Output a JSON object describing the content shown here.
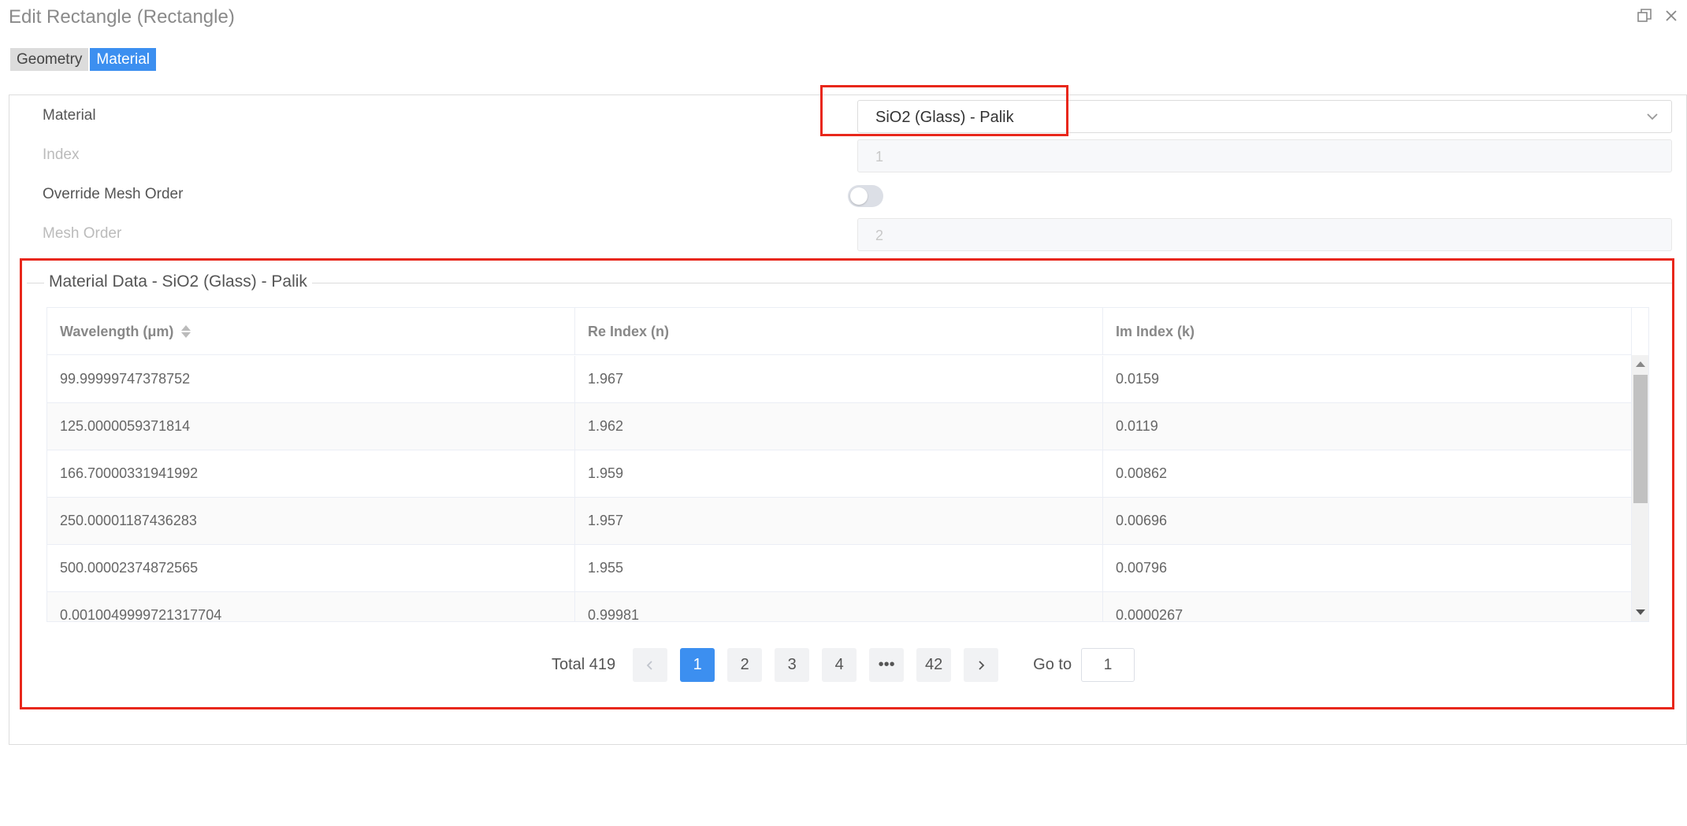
{
  "window": {
    "title": "Edit Rectangle (Rectangle)",
    "icons": [
      "restore-icon",
      "close-icon"
    ]
  },
  "tabs": [
    {
      "label": "Geometry",
      "active": false
    },
    {
      "label": "Material",
      "active": true
    }
  ],
  "form": {
    "material_label": "Material",
    "material_value": "SiO2 (Glass) - Palik",
    "index_label": "Index",
    "index_value": "1",
    "override_label": "Override Mesh Order",
    "override_on": false,
    "mesh_order_label": "Mesh Order",
    "mesh_order_value": "2"
  },
  "material_data": {
    "legend": "Material Data - SiO2 (Glass) - Palik",
    "columns": [
      "Wavelength (μm)",
      "Re Index (n)",
      "Im Index (k)"
    ],
    "rows": [
      [
        "99.99999747378752",
        "1.967",
        "0.0159"
      ],
      [
        "125.0000059371814",
        "1.962",
        "0.0119"
      ],
      [
        "166.70000331941992",
        "1.959",
        "0.00862"
      ],
      [
        "250.00001187436283",
        "1.957",
        "0.00696"
      ],
      [
        "500.00002374872565",
        "1.955",
        "0.00796"
      ],
      [
        "0.0010049999721317704",
        "0.99981",
        "0.0000267"
      ]
    ]
  },
  "pagination": {
    "total_label": "Total 419",
    "pages": [
      "1",
      "2",
      "3",
      "4",
      "•••",
      "42"
    ],
    "current": "1",
    "goto_label": "Go to",
    "goto_value": "1"
  },
  "colors": {
    "accent": "#3c8ff0",
    "highlight": "#e8271b"
  }
}
